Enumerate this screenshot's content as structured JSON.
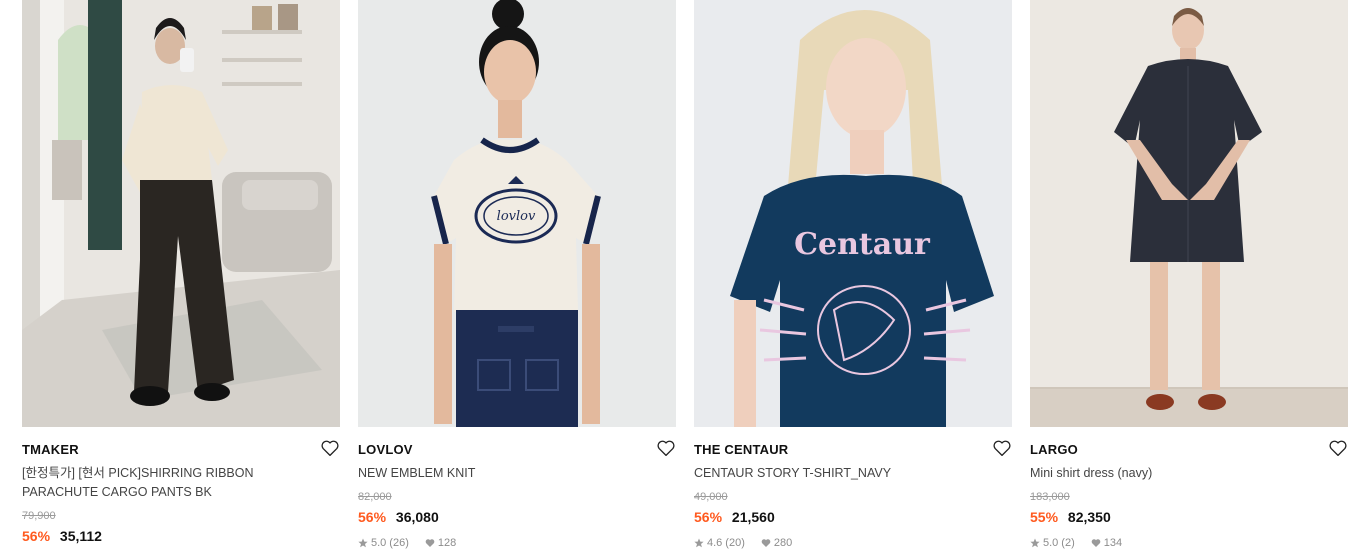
{
  "products": [
    {
      "brand": "TMAKER",
      "name": "[한정특가] [현서 PICK]SHIRRING RIBBON PARACHUTE CARGO PANTS BK",
      "original_price": "79,900",
      "discount": "56%",
      "price": "35,112",
      "rating": "",
      "reviews": "",
      "likes": "",
      "has_meta": false
    },
    {
      "brand": "LOVLOV",
      "name": "NEW EMBLEM KNIT",
      "original_price": "82,000",
      "discount": "56%",
      "price": "36,080",
      "rating": "5.0",
      "reviews": "(26)",
      "likes": "128",
      "has_meta": true
    },
    {
      "brand": "THE CENTAUR",
      "name": "CENTAUR STORY T-SHIRT_NAVY",
      "original_price": "49,000",
      "discount": "56%",
      "price": "21,560",
      "rating": "4.6",
      "reviews": "(20)",
      "likes": "280",
      "has_meta": true
    },
    {
      "brand": "LARGO",
      "name": "Mini shirt dress (navy)",
      "original_price": "183,000",
      "discount": "55%",
      "price": "82,350",
      "rating": "5.0",
      "reviews": "(2)",
      "likes": "134",
      "has_meta": true
    }
  ],
  "colors": {
    "discount": "#ff5a1f",
    "muted": "#8c8c8c"
  },
  "icons": {
    "wishlist": "heart-outline-icon",
    "rating": "star-icon",
    "likes": "heart-filled-icon"
  }
}
